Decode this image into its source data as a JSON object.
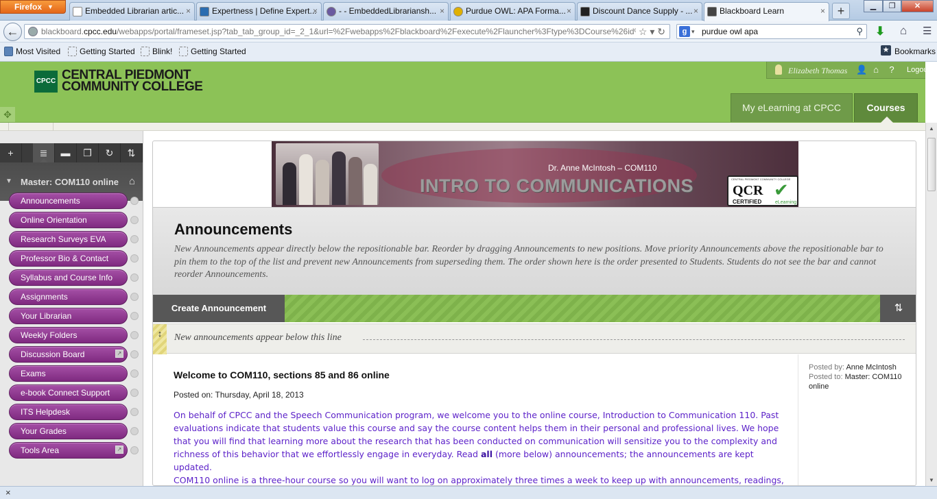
{
  "browser": {
    "app_button": "Firefox",
    "tabs": [
      {
        "title": "Embedded Librarian artic...",
        "active": false
      },
      {
        "title": "Expertness | Define Expert...",
        "active": false
      },
      {
        "title": "- - EmbeddedLibrariansh...",
        "active": false
      },
      {
        "title": "Purdue OWL: APA Forma...",
        "active": false
      },
      {
        "title": "Discount Dance Supply - ...",
        "active": false
      },
      {
        "title": "Blackboard Learn",
        "active": true
      }
    ],
    "url_domain_prefix": "blackboard.",
    "url_domain": "cpcc.edu",
    "url_path": "/webapps/portal/frameset.jsp?tab_tab_group_id=_2_1&url=%2Fwebapps%2Fblackboard%2Fexecute%2Flauncher%3Ftype%3DCourse%26id%3",
    "search_value": "purdue owl apa",
    "bookmarks": [
      "Most Visited",
      "Getting Started",
      "Blink!",
      "Getting Started"
    ],
    "bookmarks_menu": "Bookmarks"
  },
  "header": {
    "college_line1": "CENTRAL PIEDMONT",
    "college_line2": "COMMUNITY COLLEGE",
    "logo_mark": "CPCC",
    "user_name": "Elizabeth Thomas",
    "logout": "Logout",
    "tabs": [
      "My eLearning at CPCC",
      "Courses"
    ]
  },
  "sidebar": {
    "course_title": "Master: COM110 online",
    "items": [
      {
        "label": "Announcements"
      },
      {
        "label": "Online Orientation"
      },
      {
        "label": "Research Surveys EVA"
      },
      {
        "label": "Professor Bio & Contact"
      },
      {
        "label": "Syllabus and Course Info"
      },
      {
        "label": "Assignments"
      },
      {
        "label": "Your Librarian"
      },
      {
        "label": "Weekly Folders"
      },
      {
        "label": "Discussion Board"
      },
      {
        "label": "Exams"
      },
      {
        "label": "e-book Connect Support"
      },
      {
        "label": "ITS Helpdesk"
      },
      {
        "label": "Your Grades"
      },
      {
        "label": "Tools Area"
      }
    ]
  },
  "banner": {
    "professor": "Dr. Anne McIntosh – COM110",
    "title": "INTRO TO COMMUNICATIONS",
    "badge_small": "CENTRAL PIEDMONT COMMUNITY COLLEGE",
    "badge_big": "QCR",
    "badge_cert": "CERTIFIED",
    "badge_sub": "eLearning"
  },
  "page": {
    "title": "Announcements",
    "description": "New Announcements appear directly below the repositionable bar. Reorder by dragging Announcements to new positions. Move priority Announcements above the repositionable bar to pin them to the top of the list and prevent new Announcements from superseding them. The order shown here is the order presented to Students. Students do not see the bar and cannot reorder Announcements.",
    "create_button": "Create Announcement",
    "new_line_text": "New announcements appear below this line"
  },
  "announcement": {
    "title": "Welcome to COM110, sections 85 and 86 online",
    "posted_on": "Posted on: Thursday, April 18, 2013",
    "body_before": "On behalf of CPCC and the Speech Communication program, we welcome you to the online course, Introduction to Communication 110. Past evaluations indicate that students value this course and say the course content helps them in their personal and professional lives. We hope that you will find that learning more about the research that has been conducted on communication will sensitize you to the complexity and richness of this behavior that we effortlessly engage in everyday. Read ",
    "body_bold": "all",
    "body_after": " (more below) announcements; the announcements are kept updated.",
    "body2": "COM110 online is a three-hour course so you will want to log on approximately three times a week to keep up with announcements, readings,",
    "posted_by_label": "Posted by:",
    "posted_by": "Anne McIntosh",
    "posted_to_label": "Posted to:",
    "posted_to": "Master: COM110 online"
  },
  "colors": {
    "header_green": "#8cc257",
    "menu_purple": "#8f3a90",
    "body_text_purple": "#5a1fc8"
  }
}
